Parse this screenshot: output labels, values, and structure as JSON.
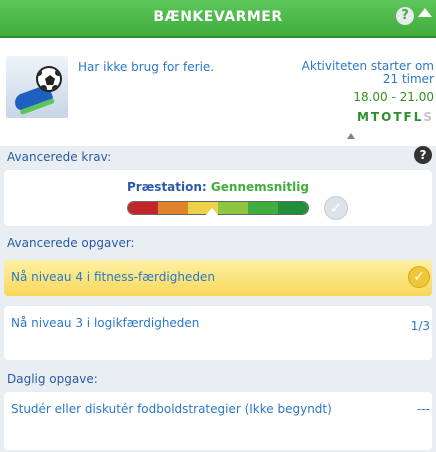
{
  "header": {
    "title": "BÆNKEVARMER",
    "help": "?"
  },
  "career": {
    "flavor": "Har ikke brug for ferie.",
    "starts_line1": "Aktiviteten starter om",
    "starts_line2": "21 timer",
    "hours": "18.00 - 21.00",
    "days_on": "MTOTFL",
    "days_off": "S"
  },
  "requirements": {
    "heading": "Avancerede krav:",
    "help": "?",
    "performance_key": "Præstation:",
    "performance_value": "Gennemsnitlig",
    "meter_colors": [
      "#c0262b",
      "#e0832a",
      "#edd24a",
      "#8fc744",
      "#3fae3d",
      "#1f8f3a"
    ]
  },
  "tasks": {
    "heading": "Avancerede opgaver:",
    "items": [
      {
        "label": "Nå niveau 4 i fitness-færdigheden",
        "done": true
      },
      {
        "label": "Nå niveau 3 i logikfærdigheden",
        "progress": "1/3"
      }
    ]
  },
  "daily": {
    "heading": "Daglig opgave:",
    "label": "Studér eller diskutér fodboldstrategier (Ikke begyndt)",
    "progress": "---"
  }
}
